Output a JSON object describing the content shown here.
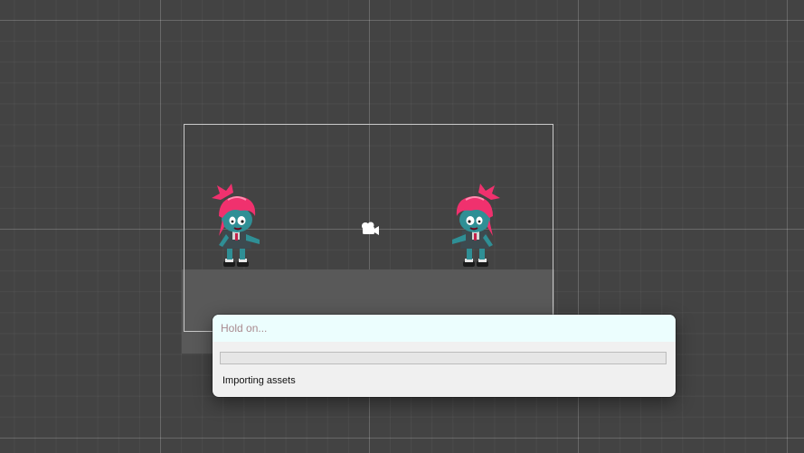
{
  "scene": {
    "icons": {
      "left_character": "zombie-girl-sprite",
      "right_character": "zombie-girl-sprite",
      "camera": "camera-gizmo-icon"
    },
    "colors": {
      "background": "#434343",
      "ground": "#595959",
      "hair": "#f0316e",
      "skin": "#2f8f95"
    }
  },
  "dialog": {
    "title": "Hold on...",
    "status": "Importing assets",
    "progress": 0
  }
}
